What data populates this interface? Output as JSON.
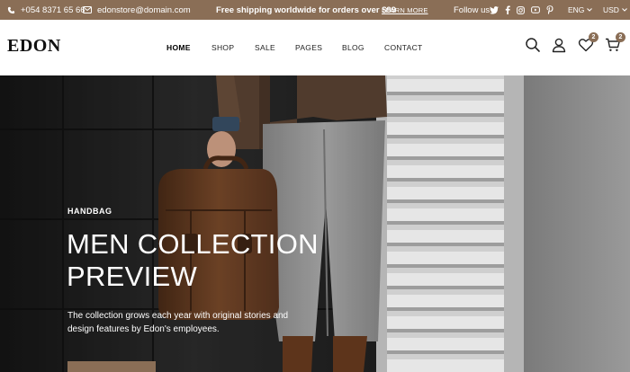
{
  "topbar": {
    "phone": "+054 8371 65 66",
    "email": "edonstore@domain.com",
    "promo": "Free shipping worldwide for orders over $99",
    "learn_more": "LEARN MORE",
    "follow_label": "Follow us",
    "social_icons": [
      "twitter-icon",
      "facebook-icon",
      "instagram-icon",
      "youtube-icon",
      "pinterest-icon"
    ],
    "language": "ENG",
    "currency": "USD"
  },
  "header": {
    "logo": "EDON",
    "nav": {
      "home": "HOME",
      "shop": "SHOP",
      "sale": "SALE",
      "pages": "PAGES",
      "blog": "BLOG",
      "contact": "CONTACT"
    },
    "wishlist_count": "2",
    "cart_count": "2"
  },
  "hero": {
    "eyebrow": "HANDBAG",
    "headline_line1": "MEN COLLECTION",
    "headline_line2": "PREVIEW",
    "description": "The collection grows each year with original stories and design features by Edon's employees."
  },
  "colors": {
    "accent": "#8a6e56",
    "topbar_text": "#ffffff",
    "nav_text": "#222222"
  }
}
